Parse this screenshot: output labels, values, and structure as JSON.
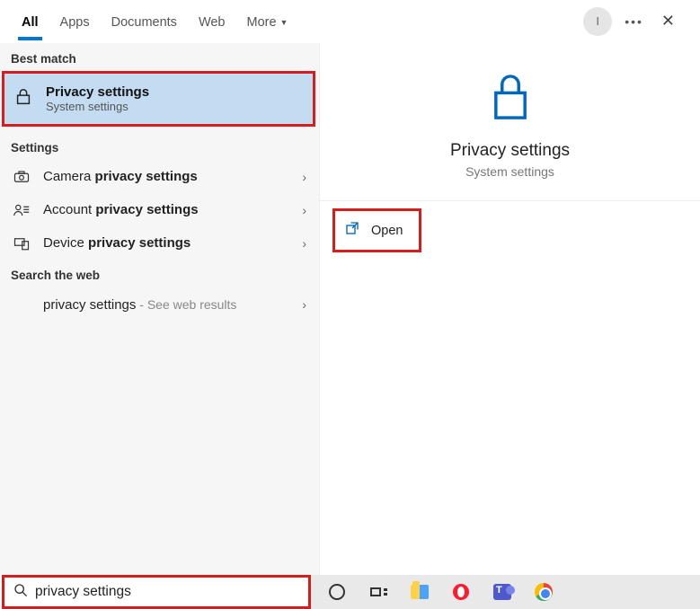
{
  "tabs": {
    "all": "All",
    "apps": "Apps",
    "documents": "Documents",
    "web": "Web",
    "more": "More"
  },
  "avatar_initial": "I",
  "sections": {
    "best_match": "Best match",
    "settings": "Settings",
    "search_web": "Search the web"
  },
  "best": {
    "title": "Privacy settings",
    "subtitle": "System settings"
  },
  "settings_rows": {
    "r0_pre": "Camera ",
    "r0_hl": "privacy settings",
    "r1_pre": "Account ",
    "r1_hl": "privacy settings",
    "r2_pre": "Device ",
    "r2_hl": "privacy settings"
  },
  "web_row": {
    "query": "privacy settings",
    "suffix": " - See web results"
  },
  "preview": {
    "title": "Privacy settings",
    "subtitle": "System settings",
    "open": "Open"
  },
  "search": {
    "value": "privacy settings"
  }
}
